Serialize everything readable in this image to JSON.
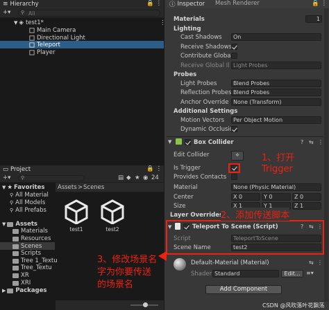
{
  "hierarchy": {
    "tab": "Hierarchy",
    "search_placeholder": "All",
    "scene": "test1*",
    "items": [
      "Main Camera",
      "Directional Light",
      "Teleport",
      "Player"
    ]
  },
  "project": {
    "tab": "Project",
    "badge": "24",
    "search_placeholder": "",
    "breadcrumb_root": "Assets",
    "breadcrumb_leaf": "Scenes",
    "favorites": "Favorites",
    "fav_items": [
      "All Material",
      "All Models",
      "All Prefabs"
    ],
    "assets": "Assets",
    "asset_folders": [
      "Materials",
      "Resources",
      "Scenes",
      "Scripts",
      "Tree 1_Textu",
      "Tree_Textu",
      "XR",
      "XRI"
    ],
    "packages": "Packages",
    "files": [
      "test1",
      "test2"
    ]
  },
  "inspector": {
    "tab": "Inspector",
    "top_cut": "Mesh Renderer",
    "materials_label": "Materials",
    "materials_count": "1",
    "lighting": "Lighting",
    "cast_shadows": "Cast Shadows",
    "cast_shadows_val": "On",
    "receive_shadows": "Receive Shadows",
    "contribute_gi": "Contribute Global",
    "receive_gi": "Receive Global Il",
    "receive_gi_val": "Light Probes",
    "probes": "Probes",
    "light_probes": "Light Probes",
    "light_probes_val": "Blend Probes",
    "reflection_probes": "Reflection Probes",
    "reflection_probes_val": "Blend Probes",
    "anchor_override": "Anchor Override",
    "anchor_override_val": "None (Transform)",
    "additional": "Additional Settings",
    "motion_vectors": "Motion Vectors",
    "motion_vectors_val": "Per Object Motion",
    "dynamic_occlusion": "Dynamic Occlusio",
    "box_collider": "Box Collider",
    "edit_collider": "Edit Collider",
    "is_trigger": "Is Trigger",
    "provides_contacts": "Provides Contacts",
    "material": "Material",
    "material_val": "None (Physic Material)",
    "center": "Center",
    "size": "Size",
    "layer_overrides": "Layer Overrides",
    "center_vals": [
      "X 0",
      "Y 0",
      "Z 0"
    ],
    "size_vals": [
      "X 1",
      "Y 1",
      "Z 1"
    ],
    "teleport_script": "Teleport To Scene (Script)",
    "script_label": "Script",
    "script_val": "TeleportToScene",
    "scene_name_label": "Scene Name",
    "scene_name_val": "test2",
    "default_material": "Default-Material (Material)",
    "shader_label": "Shader",
    "shader_val": "Standard",
    "edit_btn": "Edit...",
    "add_component": "Add Component"
  },
  "annotations": {
    "a1": "1、打开",
    "a1b": "Trigger",
    "a2": "2、添加传送脚本",
    "a3": "3、修改场景名",
    "a3b": "字为你要传送",
    "a3c": "的场景名"
  },
  "watermark": "CSDN @风吹落叶花飘荡",
  "colors": {
    "selected": "#2c5d87",
    "annotation": "#ee2211"
  }
}
